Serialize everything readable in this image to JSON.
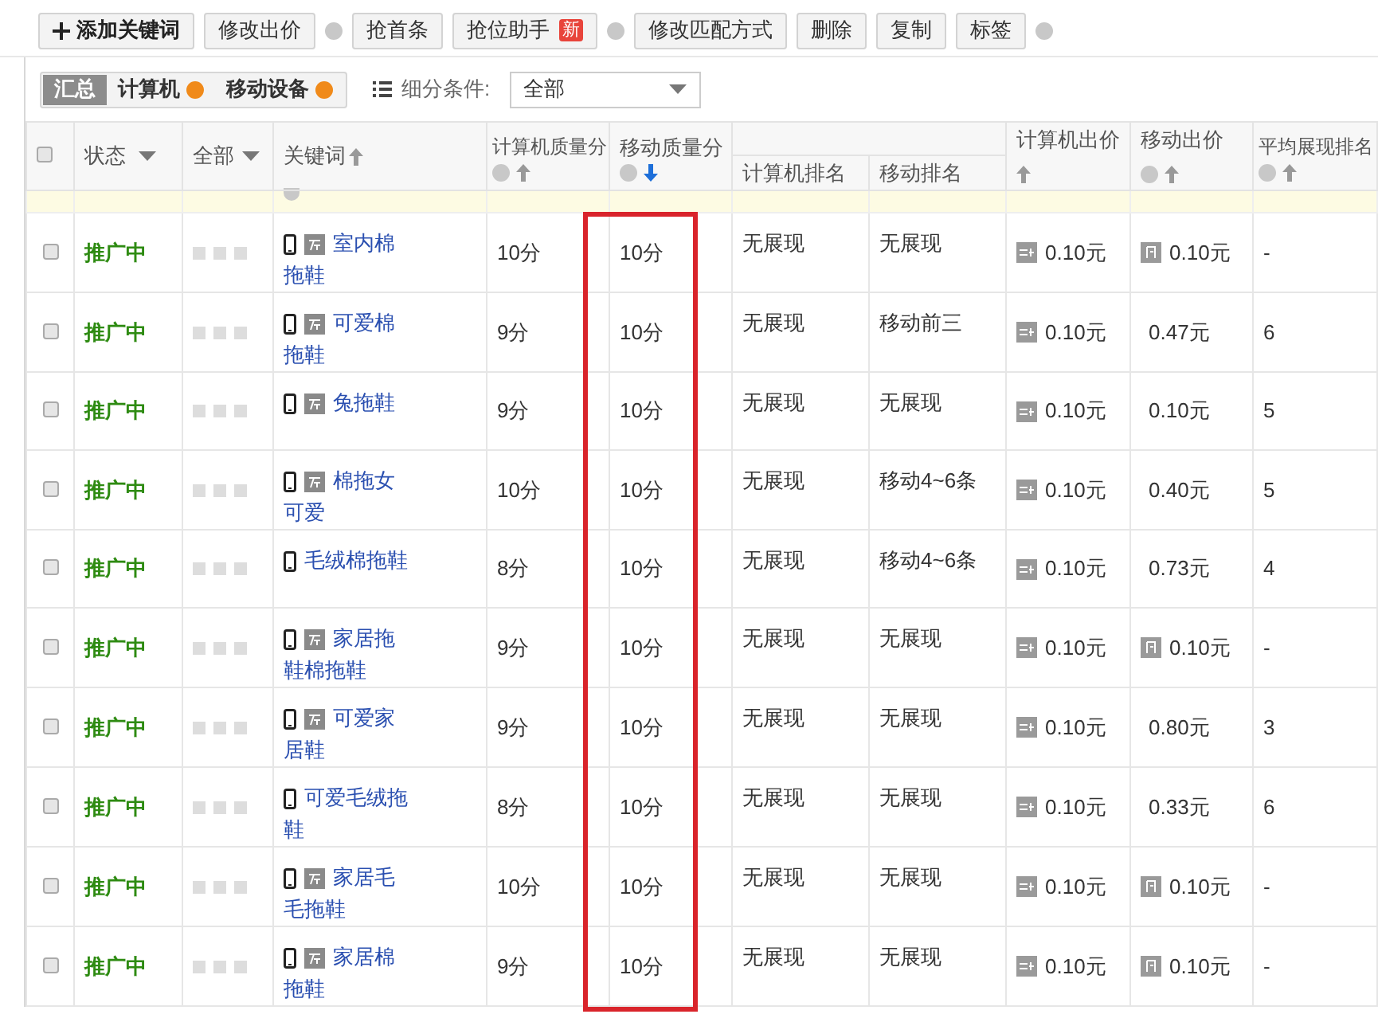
{
  "toolbar": [
    {
      "label": "添加关键词",
      "kind": "add",
      "help": false
    },
    {
      "label": "修改出价",
      "kind": "plain",
      "help": true
    },
    {
      "label": "抢首条",
      "kind": "plain",
      "help": false
    },
    {
      "label": "抢位助手",
      "kind": "new",
      "badge": "新",
      "help": true
    },
    {
      "label": "修改匹配方式",
      "kind": "plain",
      "help": false
    },
    {
      "label": "删除",
      "kind": "plain",
      "help": false
    },
    {
      "label": "复制",
      "kind": "plain",
      "help": false
    },
    {
      "label": "标签",
      "kind": "plain",
      "help": true
    }
  ],
  "tabs": [
    {
      "label": "汇总",
      "selected": true,
      "help": false
    },
    {
      "label": "计算机",
      "selected": false,
      "help": true
    },
    {
      "label": "移动设备",
      "selected": false,
      "help": true
    }
  ],
  "filter": {
    "label": "细分条件:",
    "value": "全部"
  },
  "select_all": {
    "checked": false
  },
  "columns": {
    "status": "状态",
    "all": "全部",
    "keyword": "关键词",
    "pc_quality": "计算机质量分",
    "mobile_quality": "移动质量分",
    "pc_rank": "计算机排名",
    "mobile_rank": "移动排名",
    "pc_price": "计算机出价",
    "mobile_price": "移动出价",
    "avg_rank": "平均展现排名"
  },
  "rows": [
    {
      "checked": false,
      "status": "推广中",
      "badge": true,
      "keyword": "室内棉拖鞋",
      "pc_quality": "10分",
      "mobile_quality": "10分",
      "pc_rank": "无展现",
      "mobile_rank": "无展现",
      "pc_price": "0.10元",
      "mobile_price": "0.10元",
      "mobile_price_icon": true,
      "avg_rank": "-"
    },
    {
      "checked": false,
      "status": "推广中",
      "badge": true,
      "keyword": "可爱棉拖鞋",
      "pc_quality": "9分",
      "mobile_quality": "10分",
      "pc_rank": "无展现",
      "mobile_rank": "移动前三",
      "pc_price": "0.10元",
      "mobile_price": "0.47元",
      "mobile_price_icon": false,
      "avg_rank": "6"
    },
    {
      "checked": false,
      "status": "推广中",
      "badge": true,
      "keyword": "兔拖鞋",
      "pc_quality": "9分",
      "mobile_quality": "10分",
      "pc_rank": "无展现",
      "mobile_rank": "无展现",
      "pc_price": "0.10元",
      "mobile_price": "0.10元",
      "mobile_price_icon": false,
      "avg_rank": "5"
    },
    {
      "checked": false,
      "status": "推广中",
      "badge": true,
      "keyword": "棉拖女可爱",
      "pc_quality": "10分",
      "mobile_quality": "10分",
      "pc_rank": "无展现",
      "mobile_rank": "移动4~6条",
      "pc_price": "0.10元",
      "mobile_price": "0.40元",
      "mobile_price_icon": false,
      "avg_rank": "5"
    },
    {
      "checked": false,
      "status": "推广中",
      "badge": false,
      "keyword": "毛绒棉拖鞋",
      "pc_quality": "8分",
      "mobile_quality": "10分",
      "pc_rank": "无展现",
      "mobile_rank": "移动4~6条",
      "pc_price": "0.10元",
      "mobile_price": "0.73元",
      "mobile_price_icon": false,
      "avg_rank": "4"
    },
    {
      "checked": false,
      "status": "推广中",
      "badge": true,
      "keyword": "家居拖鞋棉拖鞋",
      "pc_quality": "9分",
      "mobile_quality": "10分",
      "pc_rank": "无展现",
      "mobile_rank": "无展现",
      "pc_price": "0.10元",
      "mobile_price": "0.10元",
      "mobile_price_icon": true,
      "avg_rank": "-"
    },
    {
      "checked": false,
      "status": "推广中",
      "badge": true,
      "keyword": "可爱家居鞋",
      "pc_quality": "9分",
      "mobile_quality": "10分",
      "pc_rank": "无展现",
      "mobile_rank": "无展现",
      "pc_price": "0.10元",
      "mobile_price": "0.80元",
      "mobile_price_icon": false,
      "avg_rank": "3"
    },
    {
      "checked": false,
      "status": "推广中",
      "badge": false,
      "keyword": "可爱毛绒拖鞋",
      "pc_quality": "8分",
      "mobile_quality": "10分",
      "pc_rank": "无展现",
      "mobile_rank": "无展现",
      "pc_price": "0.10元",
      "mobile_price": "0.33元",
      "mobile_price_icon": false,
      "avg_rank": "6"
    },
    {
      "checked": false,
      "status": "推广中",
      "badge": true,
      "keyword": "家居毛毛拖鞋",
      "pc_quality": "10分",
      "mobile_quality": "10分",
      "pc_rank": "无展现",
      "mobile_rank": "无展现",
      "pc_price": "0.10元",
      "mobile_price": "0.10元",
      "mobile_price_icon": true,
      "avg_rank": "-"
    },
    {
      "checked": false,
      "status": "推广中",
      "badge": true,
      "keyword": "家居棉拖鞋",
      "pc_quality": "9分",
      "mobile_quality": "10分",
      "pc_rank": "无展现",
      "mobile_rank": "无展现",
      "pc_price": "0.10元",
      "mobile_price": "0.10元",
      "mobile_price_icon": true,
      "avg_rank": "-"
    }
  ]
}
